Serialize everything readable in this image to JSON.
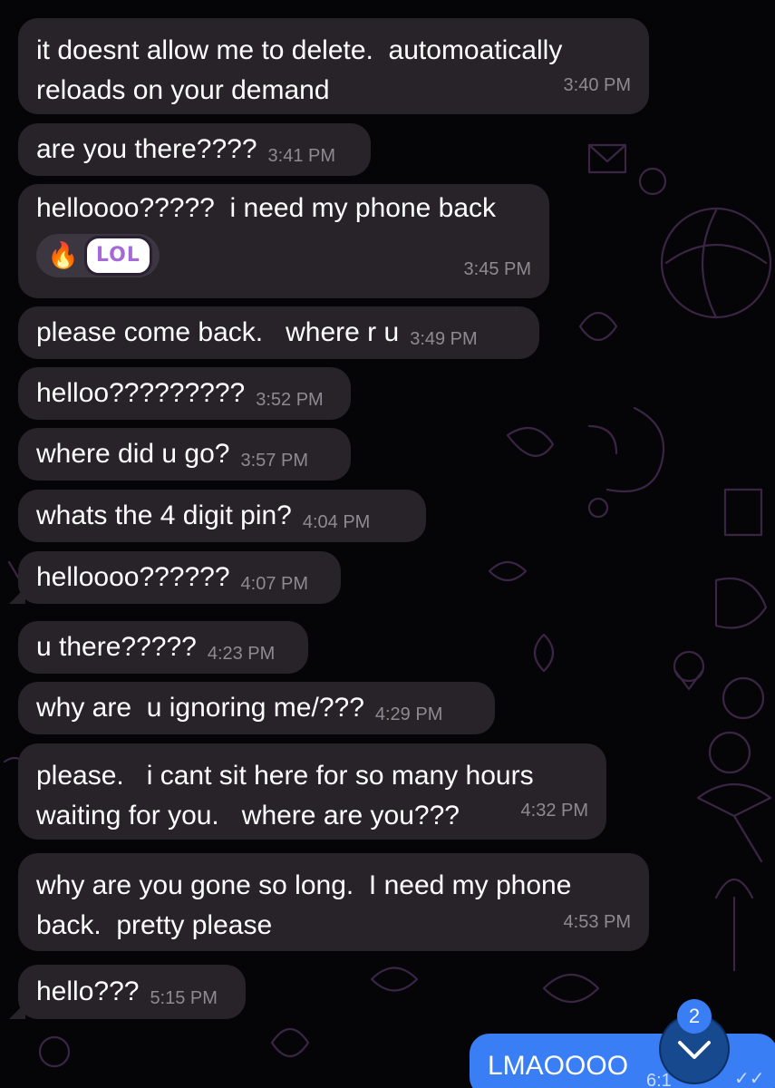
{
  "messages": [
    {
      "lines": [
        "it doesnt allow me to delete.  automoatically",
        "reloads on your demand"
      ],
      "time": "3:40 PM"
    },
    {
      "lines": [
        "are you there????"
      ],
      "time": "3:41 PM"
    },
    {
      "lines": [
        "helloooo?????  i need my phone back"
      ],
      "time": "3:45 PM",
      "reactions": {
        "emoji": "🔥",
        "sticker": "LOL"
      }
    },
    {
      "lines": [
        "please come back.   where r u"
      ],
      "time": "3:49 PM"
    },
    {
      "lines": [
        "helloo?????????"
      ],
      "time": "3:52 PM"
    },
    {
      "lines": [
        "where did u go?"
      ],
      "time": "3:57 PM"
    },
    {
      "lines": [
        "whats the 4 digit pin?"
      ],
      "time": "4:04 PM"
    },
    {
      "lines": [
        "helloooo??????"
      ],
      "time": "4:07 PM"
    },
    {
      "lines": [
        "u there?????"
      ],
      "time": "4:23 PM"
    },
    {
      "lines": [
        "why are  u ignoring me/???"
      ],
      "time": "4:29 PM"
    },
    {
      "lines": [
        "please.   i cant sit here for so many hours",
        "waiting for you.   where are you???"
      ],
      "time": "4:32 PM"
    },
    {
      "lines": [
        "why are you gone so long.  I need my phone",
        "back.  pretty please"
      ],
      "time": "4:53 PM"
    },
    {
      "lines": [
        "hello???"
      ],
      "time": "5:15 PM"
    }
  ],
  "outgoing": {
    "text": "LMAOOOO",
    "time": "6:1",
    "status": "✓✓"
  },
  "scroll_down": {
    "unread_count": "2",
    "icon": "chevron-down-icon"
  },
  "colors": {
    "incoming_bubble": "#272329",
    "outgoing_bubble": "#3a7ef6",
    "accent": "#3a7ef6"
  }
}
